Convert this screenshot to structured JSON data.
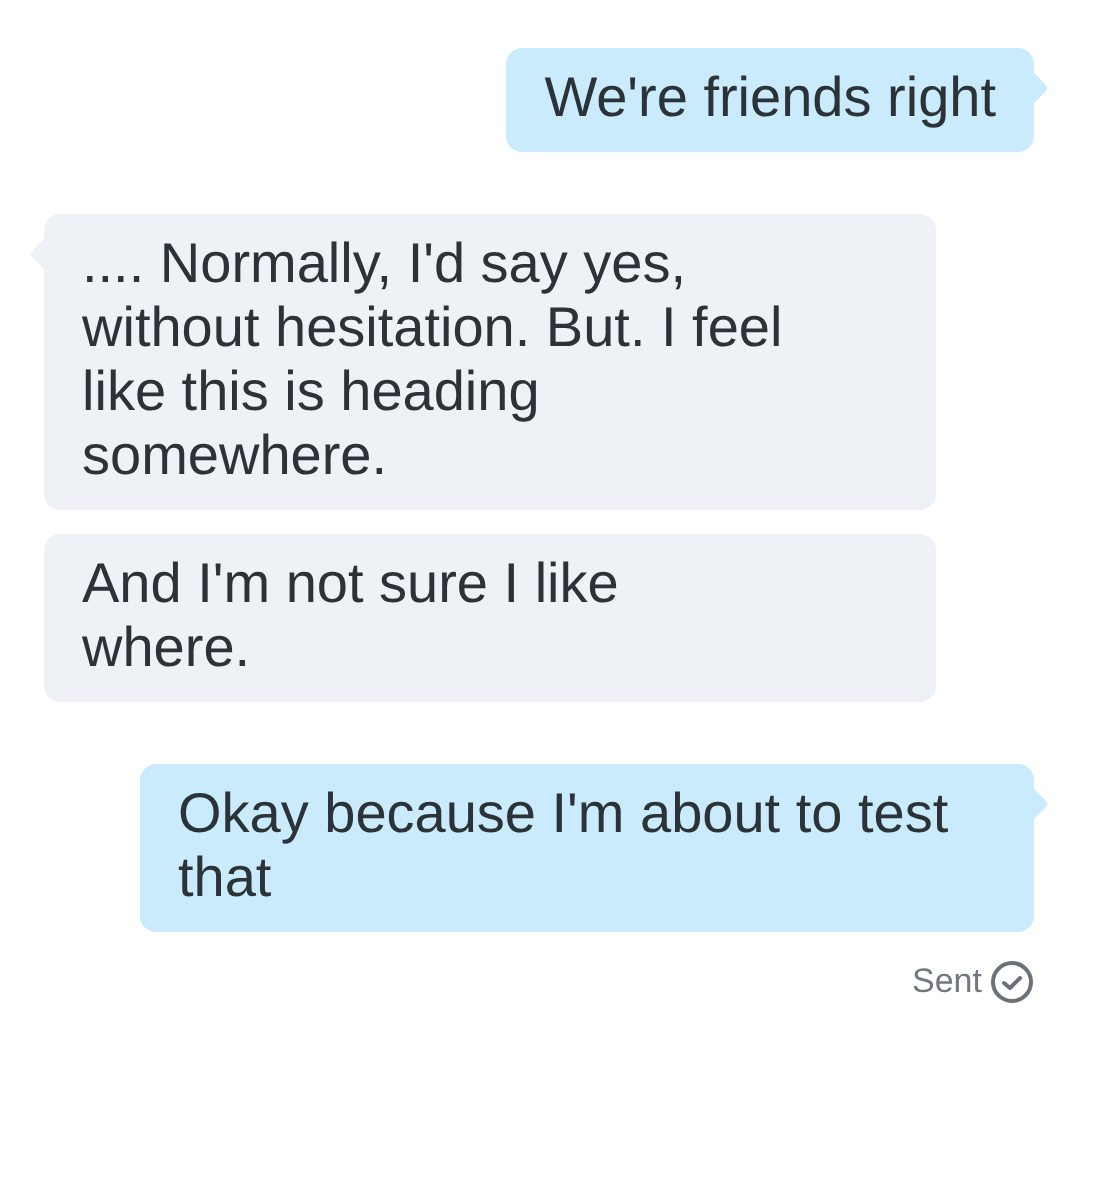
{
  "messages": [
    {
      "kind": "outgoing",
      "tail": true,
      "text": "We're friends right"
    },
    {
      "kind": "incoming",
      "tail": true,
      "text": ".... Normally, I'd say yes, without hesitation. But. I feel like this is heading somewhere."
    },
    {
      "kind": "incoming",
      "tail": false,
      "text": "And I'm not sure I like where."
    },
    {
      "kind": "outgoing",
      "tail": true,
      "text": "Okay because I'm about to test that"
    }
  ],
  "status": {
    "text": "Sent"
  }
}
